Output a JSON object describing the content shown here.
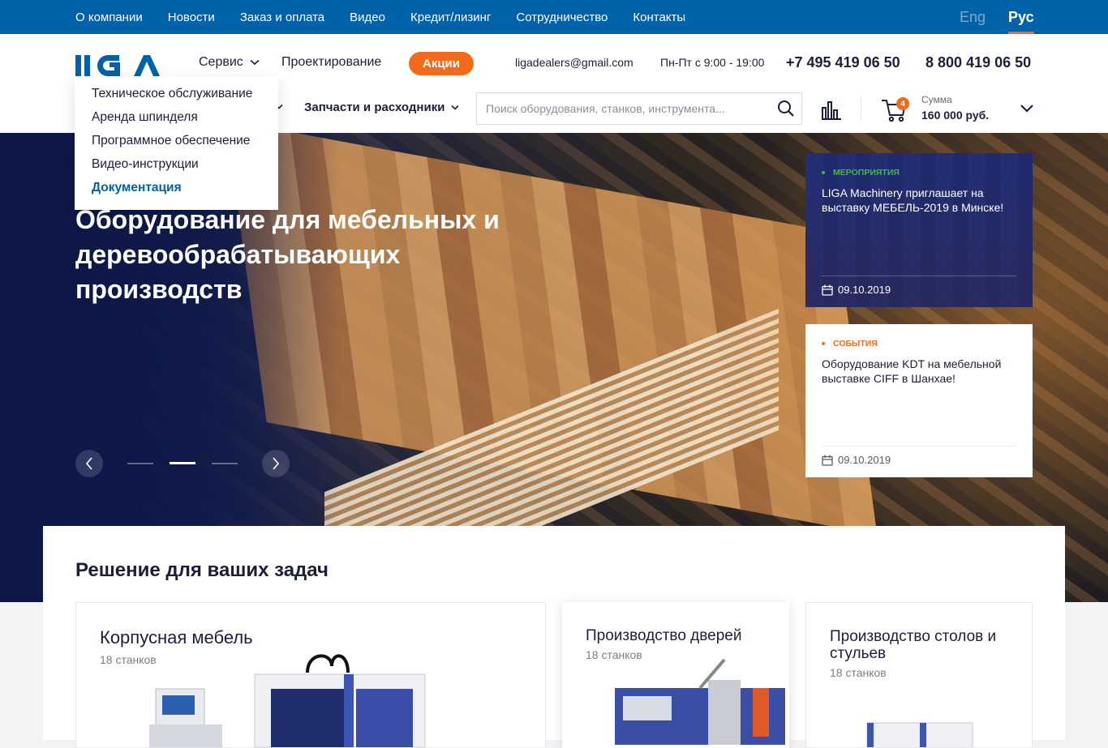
{
  "topnav": [
    "О компании",
    "Новости",
    "Заказ и оплата",
    "Видео",
    "Кредит/лизинг",
    "Сотрудничество",
    "Контакты"
  ],
  "lang": {
    "en": "Eng",
    "ru": "Рус"
  },
  "header": {
    "logo_text": "LIGA",
    "service": "Сервис",
    "design": "Проектирование",
    "promo": "Акции",
    "email": "ligadealers@gmail.com",
    "hours": "Пн-Пт с 9:00 - 19:00",
    "phone1": "+7 495 419 06 50",
    "phone2": "8 800 419 06 50",
    "parts": "Запчасти и расходники",
    "search_placeholder": "Поиск оборудования, станков, инструмента...",
    "cart_count": "4",
    "sum_label": "Сумма",
    "sum_value": "160 000 руб."
  },
  "service_menu": [
    "Техническое обслуживание",
    "Аренда шпинделя",
    "Программное обеспечение",
    "Видео-инструкции",
    "Документация"
  ],
  "service_menu_active": 4,
  "hero": {
    "title": "Оборудование для мебельных и деревообрабатывающих производств",
    "slide_active": 1,
    "slides": 3
  },
  "news": [
    {
      "tag": "Мероприятия",
      "title": "LIGA Machinery приглашает на выставку МЕБЕЛЬ-2019 в Минске!",
      "date": "09.10.2019",
      "tag_color": "#3dbb3d"
    },
    {
      "tag": "События",
      "title": "Оборудование KDT на мебельной выставке CIFF в Шанхае!",
      "date": "09.10.2019",
      "tag_color": "#f26a1b"
    }
  ],
  "solutions": {
    "title": "Решение для ваших задач",
    "cards": [
      {
        "title": "Корпусная мебель",
        "count": "18 станков"
      },
      {
        "title": "Производство дверей",
        "count": "18 станков"
      },
      {
        "title": "Производство столов и стульев",
        "count": "18 станков"
      }
    ]
  },
  "colors": {
    "brand": "#0062a8",
    "accent": "#f26a1b",
    "text": "#1b1f3b"
  }
}
